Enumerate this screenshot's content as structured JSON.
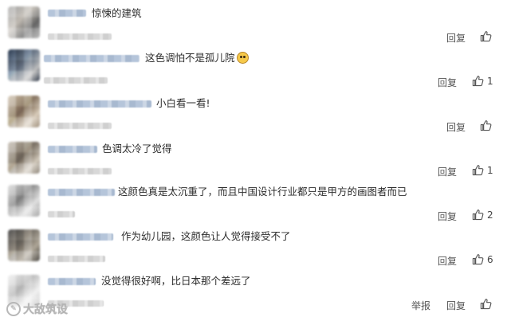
{
  "comments": [
    {
      "text": "惊悚的建筑",
      "emoji": false,
      "reply": "回复",
      "likes": ""
    },
    {
      "text": "这色调怕不是孤儿院",
      "emoji": true,
      "reply": "回复",
      "likes": "1"
    },
    {
      "text": "小白看一看!",
      "emoji": false,
      "reply": "回复",
      "likes": ""
    },
    {
      "text": "色调太冷了觉得",
      "emoji": false,
      "reply": "回复",
      "likes": "1"
    },
    {
      "text": "这颜色真是太沉重了，而且中国设计行业都只是甲方的画图者而已",
      "emoji": false,
      "reply": "回复",
      "likes": "2"
    },
    {
      "text": "作为幼儿园，这颜色让人觉得接受不了",
      "emoji": false,
      "reply": "回复",
      "likes": "6"
    },
    {
      "text": "没觉得很好啊，比日本那个差远了",
      "emoji": false,
      "reply": "回复",
      "likes": "",
      "report": "举报"
    }
  ],
  "watermark": {
    "text": "大敌筑设",
    "icon": "chat-bubble-icon"
  },
  "icons": {
    "like": "thumbs-up-icon"
  },
  "colors": {
    "text": "#2d2d2d",
    "action": "#555555",
    "nickname_blur": "#aebfd6",
    "meta_blur": "#d8d8d8"
  }
}
